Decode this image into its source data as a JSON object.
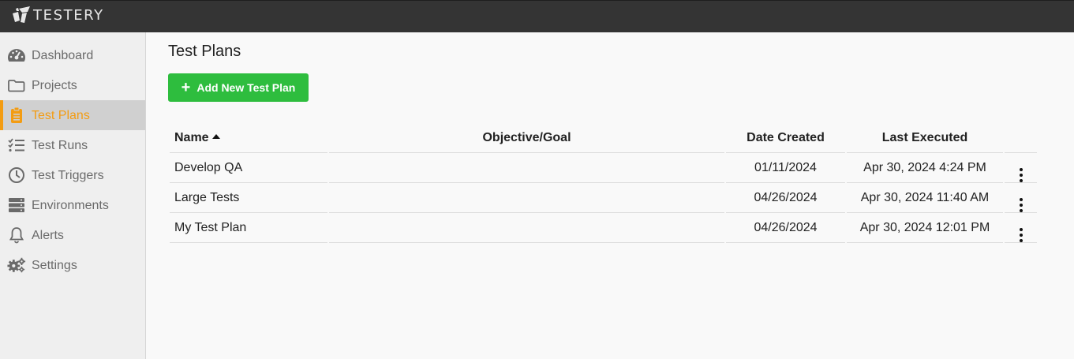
{
  "app": {
    "brand": "TESTERY"
  },
  "colors": {
    "accent": "#f39c12",
    "add_button": "#2ebd3e",
    "topbar": "#343434"
  },
  "sidebar": {
    "items": [
      {
        "label": "Dashboard",
        "icon": "dashboard-gauge-icon"
      },
      {
        "label": "Projects",
        "icon": "folder-icon"
      },
      {
        "label": "Test Plans",
        "icon": "clipboard-icon",
        "active": true
      },
      {
        "label": "Test Runs",
        "icon": "checklist-icon"
      },
      {
        "label": "Test Triggers",
        "icon": "clock-icon"
      },
      {
        "label": "Environments",
        "icon": "server-icon"
      },
      {
        "label": "Alerts",
        "icon": "bell-icon"
      },
      {
        "label": "Settings",
        "icon": "gears-icon"
      }
    ]
  },
  "main": {
    "title": "Test Plans",
    "add_button": "Add New Test Plan",
    "table": {
      "columns": [
        "Name",
        "Objective/Goal",
        "Date Created",
        "Last Executed"
      ],
      "sorted_column": "Name",
      "sort_direction": "ascending",
      "rows": [
        {
          "name": "Develop QA",
          "objective": "",
          "date_created": "01/11/2024",
          "last_executed": "Apr 30, 2024 4:24 PM"
        },
        {
          "name": "Large Tests",
          "objective": "",
          "date_created": "04/26/2024",
          "last_executed": "Apr 30, 2024 11:40 AM"
        },
        {
          "name": "My Test Plan",
          "objective": "",
          "date_created": "04/26/2024",
          "last_executed": "Apr 30, 2024 12:01 PM"
        }
      ]
    }
  }
}
